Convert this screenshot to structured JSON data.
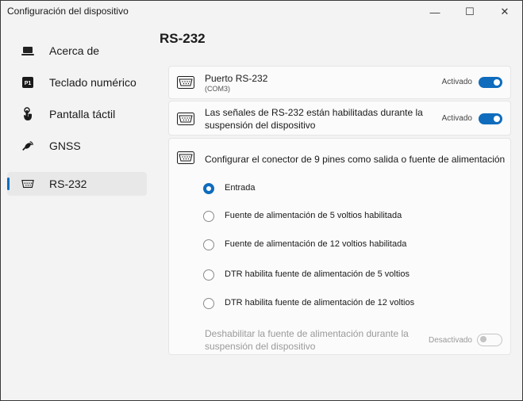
{
  "window": {
    "title": "Configuración del dispositivo",
    "minimize": "—",
    "maximize": "☐",
    "close": "✕"
  },
  "sidebar": {
    "items": [
      {
        "label": "Acerca de",
        "icon": "laptop-icon"
      },
      {
        "label": "Teclado numérico",
        "icon": "keypad-icon",
        "icon_text": "P1"
      },
      {
        "label": "Pantalla táctil",
        "icon": "touch-icon"
      },
      {
        "label": "GNSS",
        "icon": "satellite-icon"
      },
      {
        "label": "RS-232",
        "icon": "serial-port-icon",
        "active": true
      }
    ]
  },
  "page": {
    "title": "RS-232",
    "port_card": {
      "title": "Puerto RS-232",
      "subtitle": "(COM3)",
      "toggle_label": "Activado",
      "toggle_on": true
    },
    "suspend_card": {
      "title_line1": "Las señales de RS-232 están habilitadas durante la",
      "title_line2": "suspensión del dispositivo",
      "toggle_label": "Activado",
      "toggle_on": true
    },
    "connector_card": {
      "title": "Configurar el conector de 9 pines como salida o fuente de alimentación",
      "options": [
        {
          "label": "Entrada",
          "checked": true
        },
        {
          "label": "Fuente de alimentación de 5 voltios habilitada",
          "checked": false
        },
        {
          "label": "Fuente de alimentación de 12 voltios habilitada",
          "checked": false
        },
        {
          "label": "DTR habilita fuente de alimentación de 5 voltios",
          "checked": false
        },
        {
          "label": "DTR habilita fuente de alimentación de 12 voltios",
          "checked": false
        }
      ],
      "disable_line1": "Deshabilitar la fuente de alimentación durante la",
      "disable_line2": "suspensión del dispositivo",
      "disable_toggle_label": "Desactivado",
      "disable_toggle_on": false
    }
  },
  "colors": {
    "accent": "#0f6cbd",
    "background": "#f3f3f3",
    "card": "#fbfbfb"
  }
}
